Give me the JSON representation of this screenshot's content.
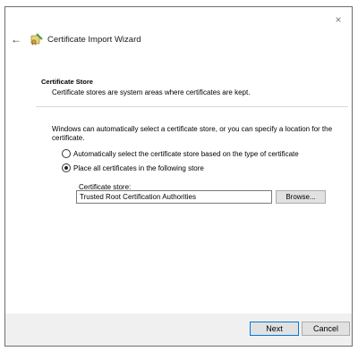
{
  "window": {
    "title": "Certificate Import Wizard",
    "close_glyph": "×",
    "back_glyph": "←",
    "icons": {
      "close": "close-icon",
      "back": "back-arrow-icon",
      "wizard": "certificate-icon"
    }
  },
  "section": {
    "heading": "Certificate Store",
    "description": "Certificate stores are system areas where certificates are kept."
  },
  "intro": "Windows can automatically select a certificate store, or you can specify a location for the certificate.",
  "options": [
    {
      "label": "Automatically select the certificate store based on the type of certificate",
      "checked": false
    },
    {
      "label": "Place all certificates in the following store",
      "checked": true
    }
  ],
  "store": {
    "label": "Certificate store:",
    "value": "Trusted Root Certification Authorities",
    "browse_label": "Browse..."
  },
  "footer": {
    "next_label": "Next",
    "cancel_label": "Cancel"
  },
  "colors": {
    "footer_bg": "#f0f0f0",
    "focus_border": "#0078d7",
    "button_bg": "#e1e1e1"
  }
}
